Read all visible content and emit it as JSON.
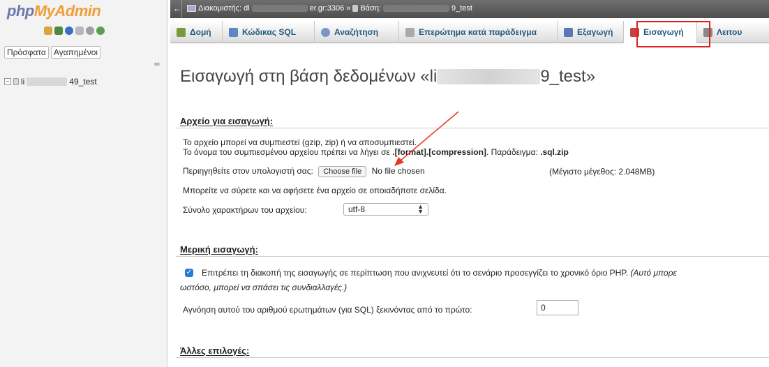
{
  "nav": {
    "logo_php": "php",
    "logo_rest": "MyAdmin",
    "recent_label": "Πρόσφατα",
    "favorites_label": "Αγαπημένοι",
    "db_prefix": "li",
    "db_suffix": "49_test",
    "icons": [
      "home-icon",
      "exit-icon",
      "help-icon",
      "docs-icon",
      "settings-icon",
      "reload-icon"
    ]
  },
  "breadcrumb": {
    "back": "←",
    "server_label": "Διακομιστής: dl",
    "server_suffix": "er.gr:3306",
    "separator": "»",
    "db_label": "Βάση:",
    "db_suffix": "9_test"
  },
  "tabs": [
    {
      "label": "Δομή",
      "icon": "structure-icon",
      "color": "#7a9b3c"
    },
    {
      "label": "Κώδικας SQL",
      "icon": "sql-icon",
      "color": "#5b88c5"
    },
    {
      "label": "Αναζήτηση",
      "icon": "search-icon",
      "color": "#7c95c7"
    },
    {
      "label": "Επερώτημα κατά παράδειγμα",
      "icon": "query-icon",
      "color": "#aaaaaa"
    },
    {
      "label": "Εξαγωγή",
      "icon": "export-icon",
      "color": "#5778b4"
    },
    {
      "label": "Εισαγωγή",
      "icon": "import-icon",
      "color": "#c84040"
    },
    {
      "label": "Λειτου",
      "icon": "operations-icon",
      "color": "#888888"
    }
  ],
  "page": {
    "title_prefix": "Εισαγωγή στη βάση δεδομένων «li",
    "title_suffix": "9_test»",
    "file_section": {
      "heading": "Αρχείο για εισαγωγή:",
      "line1": "Το αρχείο μπορεί να συμπιεστεί (gzip, zip) ή να αποσυμπιεστεί.",
      "line2_a": "Το όνομα του συμπιεσμένου αρχείου πρέπει να λήγει σε ",
      "line2_b": ".[format].[compression]",
      "line2_c": ". Παράδειγμα: ",
      "line2_d": ".sql.zip",
      "browse_label": "Περιηγηθείτε στον υπολογιστή σας:",
      "choose_button": "Choose file",
      "no_file": "No file chosen",
      "max_size": "(Μέγιστο μέγεθος: 2.048MB)",
      "drag_text": "Μπορείτε να σύρετε και να αφήσετε ένα αρχείο σε οποιαδήποτε σελίδα.",
      "charset_label": "Σύνολο χαρακτήρων του αρχείου:",
      "charset_value": "utf-8"
    },
    "partial_section": {
      "heading": "Μερική εισαγωγή:",
      "interrupt_text": "Επιτρέπει τη διακοπή της εισαγωγής σε περίπτωση που ανιχνευτεί ότι το σενάριο προσεγγίζει το χρονικό όριο PHP.",
      "interrupt_italic": "(Αυτό μπορε",
      "interrupt_italic2": "ωστόσο, μπορεί να σπάσει τις συνδιαλλαγές.)",
      "interrupt_checked": true,
      "skip_label": "Αγνόηση αυτού του αριθμού ερωτημάτων (για SQL) ξεκινόντας από το πρώτο:",
      "skip_value": "0"
    },
    "other_section": {
      "heading": "Άλλες επιλογές:"
    }
  },
  "colors": {
    "accent_blue": "#235a81",
    "highlight_red": "#e02020",
    "checkbox_blue": "#2d7bd8"
  }
}
